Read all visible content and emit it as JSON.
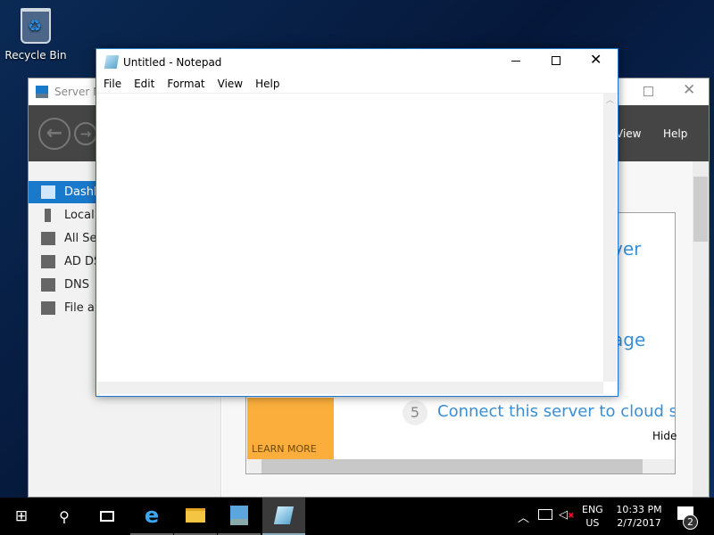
{
  "desktop": {
    "recycle_bin": "Recycle Bin"
  },
  "server_manager": {
    "title": "Server M",
    "menu_view": "View",
    "menu_help": "Help",
    "nav": [
      {
        "label": "Dashb",
        "icon": "dashboard-icon"
      },
      {
        "label": "Local",
        "icon": "server-icon"
      },
      {
        "label": "All Se",
        "icon": "servers-icon"
      },
      {
        "label": "AD DS",
        "icon": "ad-ds-icon"
      },
      {
        "label": "DNS",
        "icon": "dns-icon"
      },
      {
        "label": "File ar",
        "icon": "file-services-icon"
      }
    ],
    "welcome": {
      "line1_fragment": "ver",
      "line2_fragment": "age",
      "step_number": "5",
      "step_text": "Connect this server to cloud servic",
      "learn_more": "LEARN MORE",
      "hide": "Hide"
    }
  },
  "notepad": {
    "title": "Untitled - Notepad",
    "menu": [
      "File",
      "Edit",
      "Format",
      "View",
      "Help"
    ],
    "text": ""
  },
  "taskbar": {
    "lang_top": "ENG",
    "lang_bottom": "US",
    "time": "10:33 PM",
    "date": "2/7/2017",
    "notification_count": "2",
    "active_app": "notepad",
    "accent": "#1979d4"
  }
}
